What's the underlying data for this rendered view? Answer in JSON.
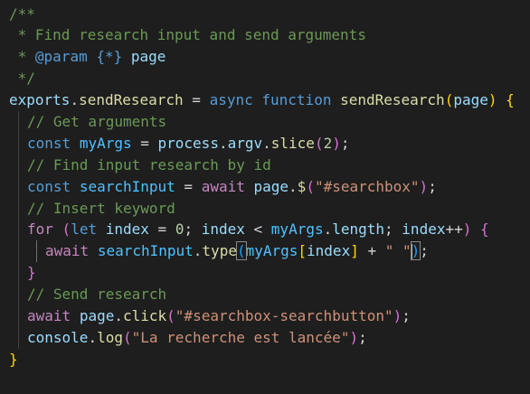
{
  "editor": {
    "language": "javascript",
    "theme": "dark",
    "colors": {
      "background": "#1e1e1e",
      "comment": "#6a9955",
      "keyword": "#569cd6",
      "control": "#c586c0",
      "function": "#dcdcaa",
      "variable": "#9cdcfe",
      "string": "#ce9178",
      "number": "#b5cea8"
    },
    "lines": [
      [
        {
          "t": "/**",
          "c": "cmt"
        }
      ],
      [
        {
          "t": " * Find research input and send arguments",
          "c": "cmt"
        }
      ],
      [
        {
          "t": " * ",
          "c": "cmt"
        },
        {
          "t": "@param",
          "c": "kw"
        },
        {
          "t": " ",
          "c": "cmt"
        },
        {
          "t": "{*}",
          "c": "kw"
        },
        {
          "t": " ",
          "c": "cmt"
        },
        {
          "t": "page",
          "c": "var"
        }
      ],
      [
        {
          "t": " */",
          "c": "cmt"
        }
      ],
      [
        {
          "t": "exports",
          "c": "var"
        },
        {
          "t": ".",
          "c": "pun"
        },
        {
          "t": "sendResearch",
          "c": "fn"
        },
        {
          "t": " = ",
          "c": "pun"
        },
        {
          "t": "async",
          "c": "kw"
        },
        {
          "t": " ",
          "c": "pun"
        },
        {
          "t": "function",
          "c": "kw"
        },
        {
          "t": " ",
          "c": "pun"
        },
        {
          "t": "sendResearch",
          "c": "fn"
        },
        {
          "t": "(",
          "c": "brk1"
        },
        {
          "t": "page",
          "c": "var"
        },
        {
          "t": ")",
          "c": "brk1"
        },
        {
          "t": " ",
          "c": "pun"
        },
        {
          "t": "{",
          "c": "brk1"
        }
      ],
      [
        {
          "t": "// Get arguments",
          "c": "cmt"
        }
      ],
      [
        {
          "t": "const",
          "c": "kw"
        },
        {
          "t": " ",
          "c": "pun"
        },
        {
          "t": "myArgs",
          "c": "cst"
        },
        {
          "t": " = ",
          "c": "pun"
        },
        {
          "t": "process",
          "c": "var"
        },
        {
          "t": ".",
          "c": "pun"
        },
        {
          "t": "argv",
          "c": "var"
        },
        {
          "t": ".",
          "c": "pun"
        },
        {
          "t": "slice",
          "c": "fn"
        },
        {
          "t": "(",
          "c": "brk2"
        },
        {
          "t": "2",
          "c": "num"
        },
        {
          "t": ")",
          "c": "brk2"
        },
        {
          "t": ";",
          "c": "pun"
        }
      ],
      [
        {
          "t": "// Find input research by id",
          "c": "cmt"
        }
      ],
      [
        {
          "t": "const",
          "c": "kw"
        },
        {
          "t": " ",
          "c": "pun"
        },
        {
          "t": "searchInput",
          "c": "cst"
        },
        {
          "t": " = ",
          "c": "pun"
        },
        {
          "t": "await",
          "c": "ctl"
        },
        {
          "t": " ",
          "c": "pun"
        },
        {
          "t": "page",
          "c": "var"
        },
        {
          "t": ".",
          "c": "pun"
        },
        {
          "t": "$",
          "c": "fn"
        },
        {
          "t": "(",
          "c": "brk2"
        },
        {
          "t": "\"#searchbox\"",
          "c": "str"
        },
        {
          "t": ")",
          "c": "brk2"
        },
        {
          "t": ";",
          "c": "pun"
        }
      ],
      [
        {
          "t": "// Insert keyword",
          "c": "cmt"
        }
      ],
      [
        {
          "t": "for",
          "c": "ctl"
        },
        {
          "t": " ",
          "c": "pun"
        },
        {
          "t": "(",
          "c": "brk2"
        },
        {
          "t": "let",
          "c": "kw"
        },
        {
          "t": " ",
          "c": "pun"
        },
        {
          "t": "index",
          "c": "var"
        },
        {
          "t": " = ",
          "c": "pun"
        },
        {
          "t": "0",
          "c": "num"
        },
        {
          "t": "; ",
          "c": "pun"
        },
        {
          "t": "index",
          "c": "var"
        },
        {
          "t": " < ",
          "c": "pun"
        },
        {
          "t": "myArgs",
          "c": "cst"
        },
        {
          "t": ".",
          "c": "pun"
        },
        {
          "t": "length",
          "c": "var"
        },
        {
          "t": "; ",
          "c": "pun"
        },
        {
          "t": "index",
          "c": "var"
        },
        {
          "t": "++",
          "c": "pun"
        },
        {
          "t": ")",
          "c": "brk2"
        },
        {
          "t": " ",
          "c": "pun"
        },
        {
          "t": "{",
          "c": "brk2"
        }
      ],
      [
        {
          "t": "await",
          "c": "ctl"
        },
        {
          "t": " ",
          "c": "pun"
        },
        {
          "t": "searchInput",
          "c": "cst"
        },
        {
          "t": ".",
          "c": "pun"
        },
        {
          "t": "type",
          "c": "fn"
        },
        {
          "t": "(",
          "c": "brk3",
          "m": true
        },
        {
          "t": "myArgs",
          "c": "cst"
        },
        {
          "t": "[",
          "c": "brk1"
        },
        {
          "t": "index",
          "c": "var"
        },
        {
          "t": "]",
          "c": "brk1"
        },
        {
          "t": " + ",
          "c": "pun"
        },
        {
          "t": "\" \"",
          "c": "str"
        },
        {
          "t": ")",
          "c": "brk3",
          "m": true,
          "cursor": true
        },
        {
          "t": ";",
          "c": "pun"
        }
      ],
      [
        {
          "t": "}",
          "c": "brk2"
        }
      ],
      [
        {
          "t": "// Send research",
          "c": "cmt"
        }
      ],
      [
        {
          "t": "await",
          "c": "ctl"
        },
        {
          "t": " ",
          "c": "pun"
        },
        {
          "t": "page",
          "c": "var"
        },
        {
          "t": ".",
          "c": "pun"
        },
        {
          "t": "click",
          "c": "fn"
        },
        {
          "t": "(",
          "c": "brk2"
        },
        {
          "t": "\"#searchbox-searchbutton\"",
          "c": "str"
        },
        {
          "t": ")",
          "c": "brk2"
        },
        {
          "t": ";",
          "c": "pun"
        }
      ],
      [
        {
          "t": "console",
          "c": "var"
        },
        {
          "t": ".",
          "c": "pun"
        },
        {
          "t": "log",
          "c": "fn"
        },
        {
          "t": "(",
          "c": "brk2"
        },
        {
          "t": "\"La recherche est lancée\"",
          "c": "str"
        },
        {
          "t": ")",
          "c": "brk2"
        },
        {
          "t": ";",
          "c": "pun"
        }
      ],
      [
        {
          "t": "}",
          "c": "brk1"
        }
      ]
    ]
  }
}
